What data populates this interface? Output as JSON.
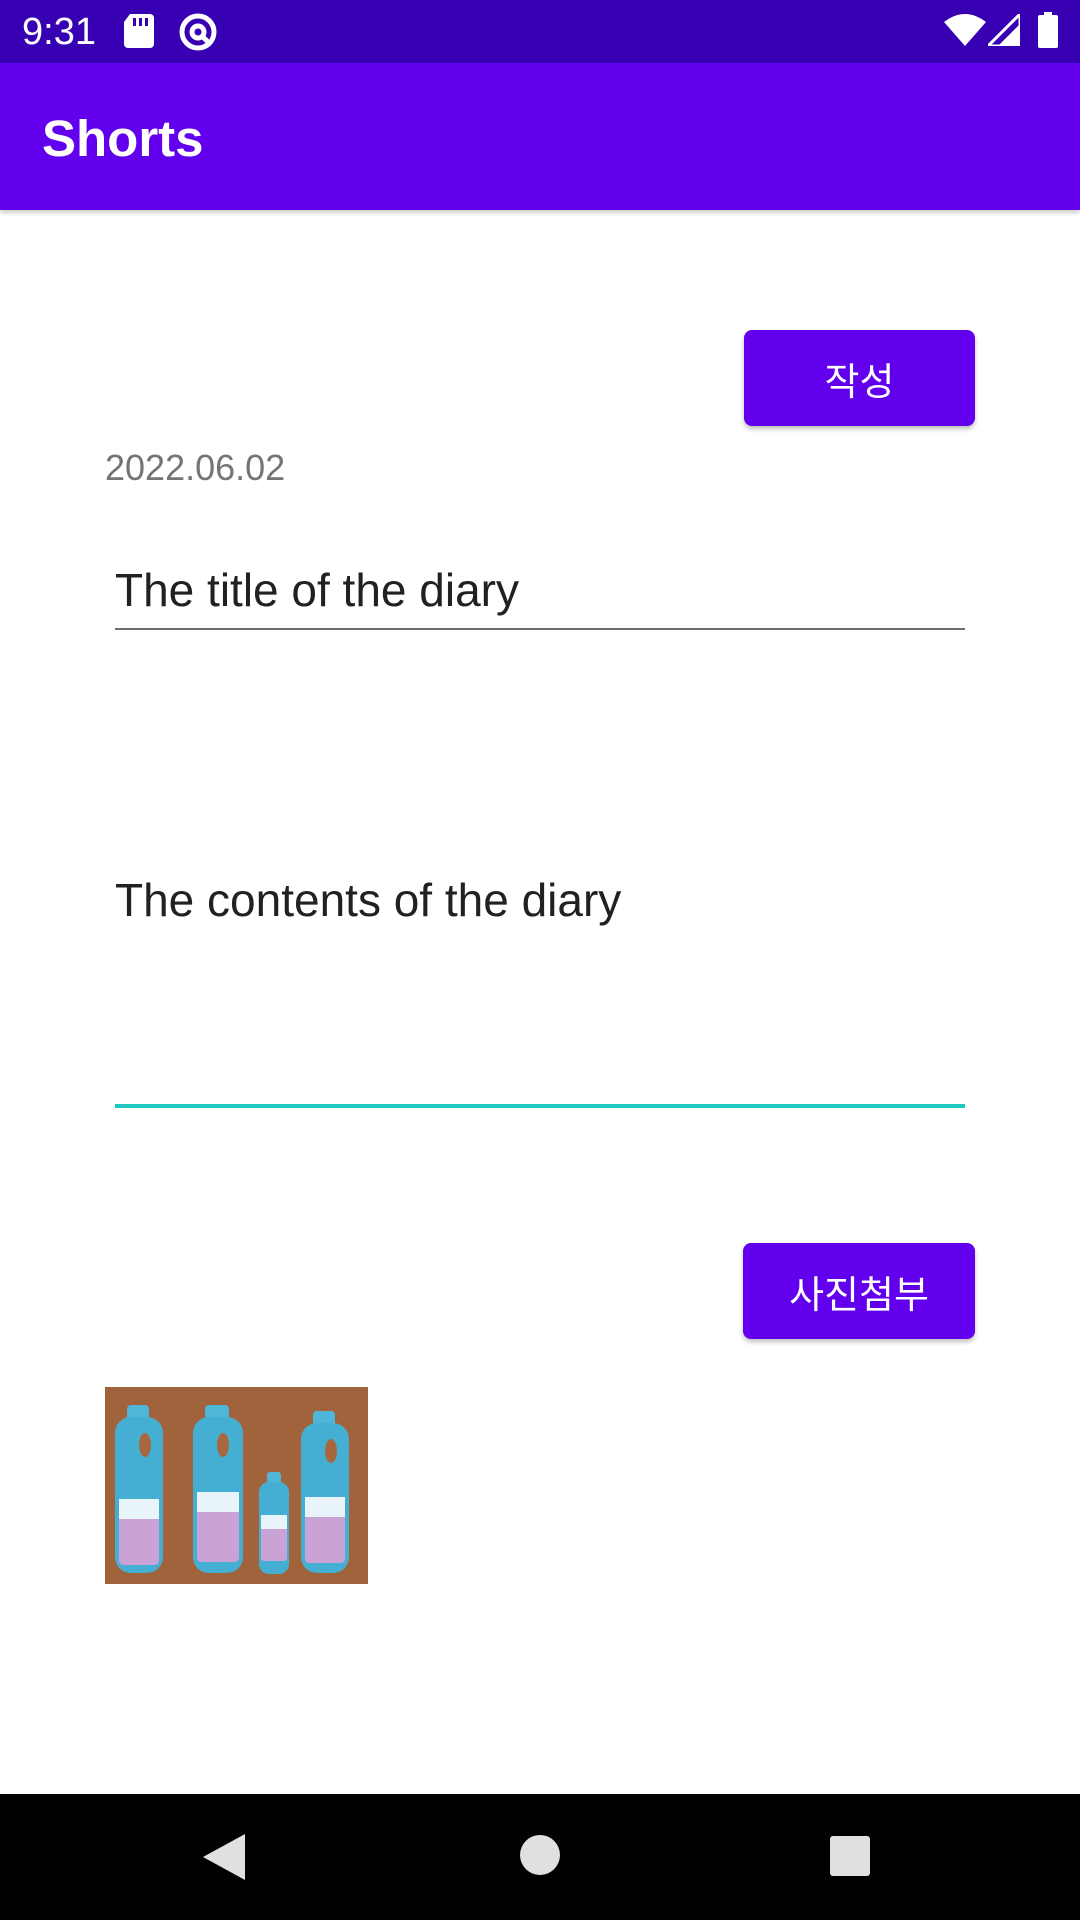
{
  "status_bar": {
    "time": "9:31",
    "icons": [
      "sd-card-icon",
      "at-sign-icon",
      "wifi-icon",
      "cell-signal-icon",
      "battery-icon"
    ]
  },
  "app_bar": {
    "title": "Shorts",
    "color": "#6200ee"
  },
  "form": {
    "write_button_label": "작성",
    "date": "2022.06.02",
    "title_value": "The title of the diary",
    "contents_value": "The contents of the diary",
    "attach_button_label": "사진첨부"
  },
  "photo": {
    "icon": "attached-photo"
  },
  "colors": {
    "status_bar": "#3700b3",
    "primary": "#6200ee",
    "accent_underline": "#1ec8be"
  }
}
